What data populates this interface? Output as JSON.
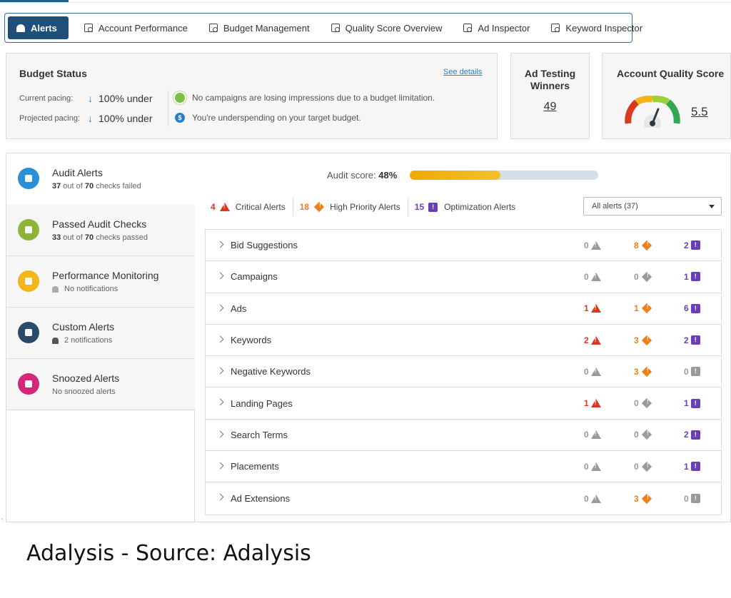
{
  "tabs": [
    {
      "label": "Alerts",
      "active": true,
      "icon": "bell-icon"
    },
    {
      "label": "Account Performance",
      "icon": "report-icon"
    },
    {
      "label": "Budget Management",
      "icon": "wallet-icon"
    },
    {
      "label": "Quality Score Overview",
      "icon": "report-icon"
    },
    {
      "label": "Ad Inspector",
      "icon": "inspect-icon"
    },
    {
      "label": "Keyword Inspector",
      "icon": "inspect-icon"
    }
  ],
  "budget": {
    "title": "Budget Status",
    "see_details": "See details",
    "current_label": "Current pacing:",
    "current_value": "100% under",
    "projected_label": "Projected pacing:",
    "projected_value": "100% under",
    "msg1": "No campaigns are losing impressions due to a budget limitation.",
    "msg2": "You're underspending on your target budget."
  },
  "ad_testing": {
    "title_line1": "Ad Testing",
    "title_line2": "Winners",
    "value": "49"
  },
  "quality": {
    "title": "Account Quality Score",
    "value": "5.5"
  },
  "sidebar": [
    {
      "title": "Audit Alerts",
      "sub_bold1": "37",
      "sub_mid": " out of ",
      "sub_bold2": "70",
      "sub_end": " checks failed",
      "color": "#2a8fd6",
      "active": true
    },
    {
      "title": "Passed Audit Checks",
      "sub_bold1": "33",
      "sub_mid": " out of ",
      "sub_bold2": "70",
      "sub_end": " checks passed",
      "color": "#8db33a"
    },
    {
      "title": "Performance Monitoring",
      "sub": "No notifications",
      "color": "#f2b61c"
    },
    {
      "title": "Custom Alerts",
      "sub": "2 notifications",
      "color": "#2b4a6a"
    },
    {
      "title": "Snoozed Alerts",
      "sub": "No snoozed alerts",
      "color": "#d6287a"
    }
  ],
  "audit": {
    "label": "Audit score:",
    "value": "48%",
    "fraction": 0.48
  },
  "counts": {
    "critical_num": "4",
    "critical_label": "Critical Alerts",
    "high_num": "18",
    "high_label": "High Priority Alerts",
    "opt_num": "15",
    "opt_label": "Optimization Alerts"
  },
  "filter": {
    "selected": "All alerts (37)"
  },
  "rows": [
    {
      "name": "Bid Suggestions",
      "c": "0",
      "h": "8",
      "o": "2"
    },
    {
      "name": "Campaigns",
      "c": "0",
      "h": "0",
      "o": "1"
    },
    {
      "name": "Ads",
      "c": "1",
      "h": "1",
      "o": "6"
    },
    {
      "name": "Keywords",
      "c": "2",
      "h": "3",
      "o": "2"
    },
    {
      "name": "Negative Keywords",
      "c": "0",
      "h": "3",
      "o": "0"
    },
    {
      "name": "Landing Pages",
      "c": "1",
      "h": "0",
      "o": "1"
    },
    {
      "name": "Search Terms",
      "c": "0",
      "h": "0",
      "o": "2"
    },
    {
      "name": "Placements",
      "c": "0",
      "h": "0",
      "o": "1"
    },
    {
      "name": "Ad Extensions",
      "c": "0",
      "h": "3",
      "o": "0"
    }
  ],
  "caption": "Adalysis - Source: Adalysis",
  "colors": {
    "brand": "#1f4e79",
    "critical": "#d9391f",
    "high": "#ef7f1a",
    "optimization": "#6a3fb5",
    "neutral": "#9a9a9a"
  }
}
